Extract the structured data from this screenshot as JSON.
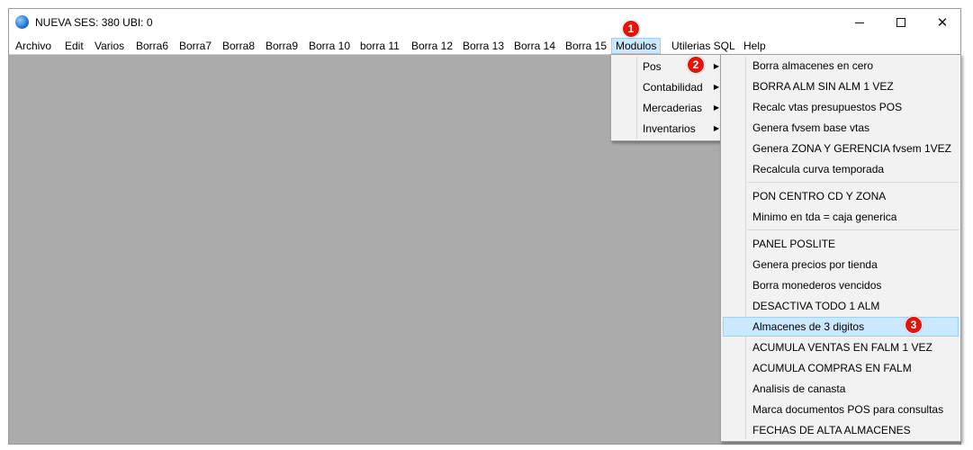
{
  "window": {
    "title": "NUEVA   SES: 380   UBI: 0",
    "minimize_symbol": "",
    "maximize_symbol": "",
    "close_symbol": "✕"
  },
  "menubar": {
    "items": [
      {
        "label": "Archivo"
      },
      {
        "label": "Edit"
      },
      {
        "label": "Varios"
      },
      {
        "label": "Borra6"
      },
      {
        "label": "Borra7"
      },
      {
        "label": "Borra8"
      },
      {
        "label": "Borra9"
      },
      {
        "label": "Borra 10"
      },
      {
        "label": "borra 11"
      },
      {
        "label": "Borra 12"
      },
      {
        "label": "Borra 13"
      },
      {
        "label": "Borra 14"
      },
      {
        "label": "Borra 15"
      },
      {
        "label": "Modulos"
      },
      {
        "label": "Utilerias SQL"
      },
      {
        "label": "Help"
      }
    ],
    "active": "Modulos"
  },
  "modulos_menu": {
    "items": [
      {
        "label": "Pos",
        "submenu_arrow": "▶"
      },
      {
        "label": "Contabilidad",
        "submenu_arrow": "▶"
      },
      {
        "label": "Mercaderias",
        "submenu_arrow": "▶"
      },
      {
        "label": "Inventarios",
        "submenu_arrow": "▶"
      }
    ]
  },
  "pos_submenu": {
    "items": [
      {
        "label": "Borra almacenes en cero"
      },
      {
        "label": "BORRA ALM SIN ALM 1 VEZ"
      },
      {
        "label": "Recalc vtas presupuestos POS"
      },
      {
        "label": "Genera fvsem base vtas"
      },
      {
        "label": "Genera ZONA Y GERENCIA fvsem 1VEZ"
      },
      {
        "label": "Recalcula curva temporada"
      },
      {
        "label": "PON CENTRO CD Y ZONA"
      },
      {
        "label": "Minimo en tda = caja generica"
      },
      {
        "label": "PANEL POSLITE"
      },
      {
        "label": "Genera precios por tienda"
      },
      {
        "label": "Borra monederos vencidos"
      },
      {
        "label": "DESACTIVA TODO 1 ALM"
      },
      {
        "label": "Almacenes de 3 digitos"
      },
      {
        "label": "ACUMULA VENTAS EN FALM  1 VEZ"
      },
      {
        "label": "ACUMULA COMPRAS EN FALM"
      },
      {
        "label": "Analisis de canasta"
      },
      {
        "label": "Marca documentos POS para consultas"
      },
      {
        "label": "FECHAS DE ALTA ALMACENES"
      }
    ],
    "highlighted": "Almacenes de 3 digitos"
  },
  "annotations": [
    {
      "label": "1"
    },
    {
      "label": "2"
    },
    {
      "label": "3"
    }
  ],
  "colors": {
    "client_background": "#ababab",
    "menu_background": "#f2f2f2",
    "highlight": "#cce8ff",
    "badge": "#e3150a"
  }
}
